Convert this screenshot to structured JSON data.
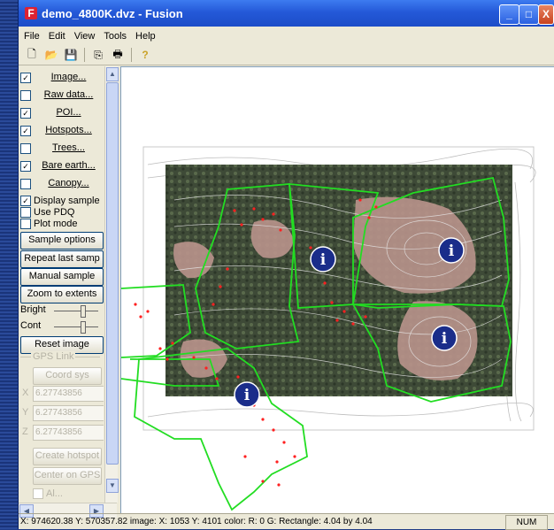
{
  "window": {
    "title": "demo_4800K.dvz - Fusion",
    "app_icon_letter": "F",
    "minimize": "_",
    "maximize": "□",
    "close": "X"
  },
  "menu": [
    "File",
    "Edit",
    "View",
    "Tools",
    "Help"
  ],
  "toolbar": {
    "icons": [
      "new-icon",
      "open-icon",
      "save-icon",
      "copy-icon",
      "print-icon",
      "help-icon"
    ],
    "glyphs": [
      "🗋",
      "📂",
      "💾",
      "⎘",
      "🖶",
      "?"
    ]
  },
  "layers": [
    {
      "label": "Image...",
      "checked": true,
      "mark": "✓"
    },
    {
      "label": "Raw data...",
      "checked": false,
      "mark": ""
    },
    {
      "label": "POI...",
      "checked": true,
      "mark": "✓"
    },
    {
      "label": "Hotspots...",
      "checked": true,
      "mark": "✓"
    },
    {
      "label": "Trees...",
      "checked": false,
      "mark": ""
    },
    {
      "label": "Bare earth...",
      "checked": true,
      "mark": "✓"
    },
    {
      "label": "Canopy...",
      "checked": false,
      "mark": ""
    }
  ],
  "options": [
    {
      "label": "Display sample",
      "checked": true,
      "mark": "✓"
    },
    {
      "label": "Use PDQ",
      "checked": false,
      "mark": ""
    },
    {
      "label": "Plot mode",
      "checked": false,
      "mark": ""
    }
  ],
  "buttons": {
    "sample_options": "Sample options",
    "repeat_last": "Repeat last samp",
    "manual_sample": "Manual sample",
    "zoom_extents": "Zoom to extents",
    "reset_image": "Reset image",
    "coord_sys": "Coord sys",
    "create_hotspot": "Create hotspot",
    "center_gps": "Center on GPS"
  },
  "sliders": {
    "bright_label": "Bright",
    "cont_label": "Cont"
  },
  "gps": {
    "group_label": "GPS Link",
    "x_label": "X",
    "y_label": "Y",
    "z_label": "Z",
    "x_value": "6.27743856",
    "y_value": "6.27743856",
    "z_value": "6.27743856",
    "partial_label": "Al..."
  },
  "status": {
    "text": "X: 974620.38  Y: 570357.82   image: X:  1053  Y:  4101    color: R:   0   G: Rectangle: 4.04 by 4.04",
    "num": "NUM"
  },
  "poi_icon_letter": "i"
}
